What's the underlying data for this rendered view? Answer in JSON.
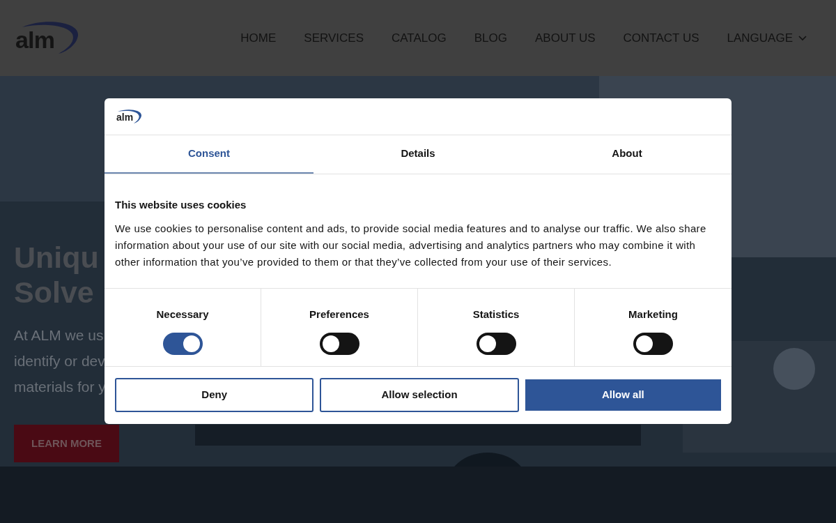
{
  "header": {
    "logo": "alm",
    "nav": [
      {
        "label": "HOME"
      },
      {
        "label": "SERVICES"
      },
      {
        "label": "CATALOG"
      },
      {
        "label": "BLOG"
      },
      {
        "label": "ABOUT US"
      },
      {
        "label": "CONTACT US"
      },
      {
        "label": "LANGUAGE",
        "dropdown": true
      }
    ]
  },
  "hero": {
    "heading_lines": [
      "Uniqu",
      "Solve"
    ],
    "body_lines": [
      "At ALM we us",
      "identify or dev",
      "materials for y"
    ],
    "button": "LEARN MORE"
  },
  "dialog": {
    "logo": "alm",
    "tabs": [
      {
        "label": "Consent",
        "selected": true
      },
      {
        "label": "Details",
        "selected": false
      },
      {
        "label": "About",
        "selected": false
      }
    ],
    "title": "This website uses cookies",
    "text": "We use cookies to personalise content and ads, to provide social media features and to analyse our traffic. We also share information about your use of our site with our social media, advertising and analytics partners who may combine it with other information that you’ve provided to them or that they’ve collected from your use of their services.",
    "toggles": [
      {
        "label": "Necessary",
        "on": true
      },
      {
        "label": "Preferences",
        "on": false
      },
      {
        "label": "Statistics",
        "on": false
      },
      {
        "label": "Marketing",
        "on": false
      }
    ],
    "buttons": [
      {
        "label": "Deny",
        "kind": "outline"
      },
      {
        "label": "Allow selection",
        "kind": "outline"
      },
      {
        "label": "Allow all",
        "kind": "filled"
      }
    ]
  }
}
